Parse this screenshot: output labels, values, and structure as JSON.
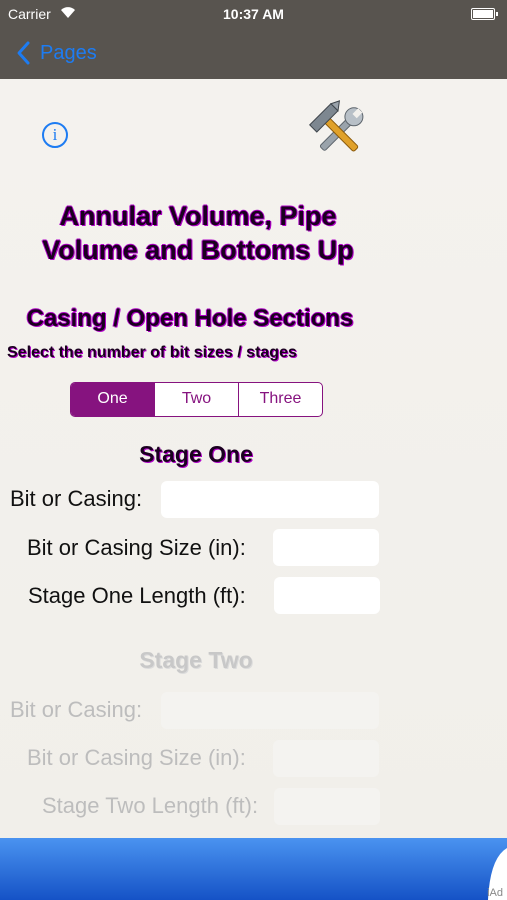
{
  "status_bar": {
    "carrier": "Carrier",
    "time": "10:37 AM"
  },
  "nav": {
    "back_label": "Pages"
  },
  "header": {
    "info_symbol": "i",
    "tools_icon": "hammer-wrench-icon"
  },
  "title": {
    "line1": "Annular Volume, Pipe",
    "line2": "Volume and Bottoms Up"
  },
  "section": {
    "heading": "Casing / Open Hole Sections",
    "instruction": "Select the number of bit sizes / stages"
  },
  "segmented": {
    "options": [
      "One",
      "Two",
      "Three"
    ],
    "selected": "One"
  },
  "stage_one": {
    "heading": "Stage One",
    "bit_or_casing_label": "Bit or Casing:",
    "size_label": "Bit or Casing Size (in):",
    "length_label": "Stage One Length (ft):",
    "bit_or_casing_value": "",
    "size_value": "",
    "length_value": ""
  },
  "stage_two": {
    "heading": "Stage Two",
    "bit_or_casing_label": "Bit or Casing:",
    "size_label": "Bit or Casing Size (in):",
    "length_label": "Stage Two Length (ft):",
    "enabled": false
  },
  "ad": {
    "label": "iAd"
  },
  "colors": {
    "accent": "#86137f",
    "link_blue": "#1d7cf2",
    "bar_bg": "#58544f",
    "ad_blue": "#1a63d8"
  }
}
